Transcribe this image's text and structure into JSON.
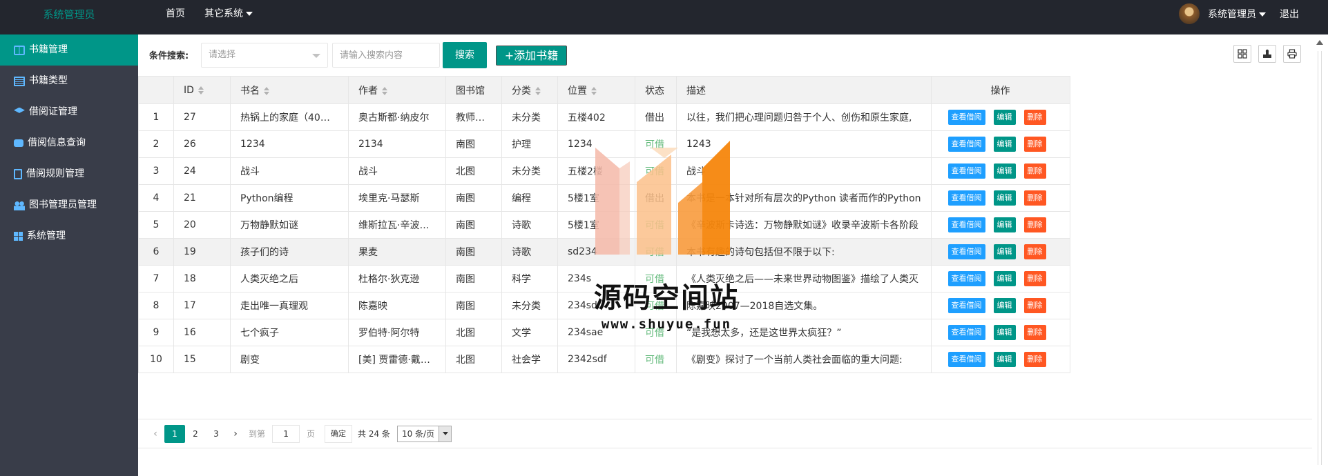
{
  "header": {
    "logo": "系统管理员",
    "nav": [
      "首页",
      "其它系统"
    ],
    "username": "系统管理员",
    "logout": "退出"
  },
  "sidebar": {
    "items": [
      {
        "label": "书籍管理",
        "icon": "book-icon",
        "active": true
      },
      {
        "label": "书籍类型",
        "icon": "list-icon",
        "active": false
      },
      {
        "label": "借阅证管理",
        "icon": "layers-icon",
        "active": false
      },
      {
        "label": "借阅信息查询",
        "icon": "chat-icon",
        "active": false
      },
      {
        "label": "借阅规则管理",
        "icon": "document-icon",
        "active": false
      },
      {
        "label": "图书管理员管理",
        "icon": "users-icon",
        "active": false
      },
      {
        "label": "系统管理",
        "icon": "windows-icon",
        "active": false
      }
    ]
  },
  "toolbar": {
    "label": "条件搜索:",
    "select_placeholder": "请选择",
    "search_placeholder": "请输入搜索内容",
    "search_button": "搜索",
    "add_button": "+添加书籍"
  },
  "table": {
    "columns": [
      "",
      "ID",
      "书名",
      "作者",
      "图书馆",
      "分类",
      "位置",
      "状态",
      "描述",
      "操作"
    ],
    "ops": {
      "view": "查看借阅",
      "edit": "编辑",
      "delete": "删除"
    },
    "rows": [
      [
        "1",
        "27",
        "热锅上的家庭（40…",
        "奥古斯都·纳皮尔",
        "教师…",
        "未分类",
        "五楼402",
        "借出",
        "以往，我们把心理问题归咎于个人、创伤和原生家庭,"
      ],
      [
        "2",
        "26",
        "1234",
        "2134",
        "南图",
        "护理",
        "1234",
        "可借",
        "1243"
      ],
      [
        "3",
        "24",
        "战斗",
        "战斗",
        "北图",
        "未分类",
        "五楼2楼",
        "可借",
        "战斗"
      ],
      [
        "4",
        "21",
        "Python编程",
        "埃里克·马瑟斯",
        "南图",
        "编程",
        "5楼1室",
        "借出",
        "本书是一本针对所有层次的Python 读者而作的Python"
      ],
      [
        "5",
        "20",
        "万物静默如谜",
        "维斯拉瓦·辛波…",
        "南图",
        "诗歌",
        "5楼1室",
        "可借",
        "《辛波斯卡诗选：万物静默如谜》收录辛波斯卡各阶段"
      ],
      [
        "6",
        "19",
        "孩子们的诗",
        "果麦",
        "南图",
        "诗歌",
        "sd234",
        "可借",
        "本书有趣的诗句包括但不限于以下:"
      ],
      [
        "7",
        "18",
        "人类灭绝之后",
        "杜格尔·狄克逊",
        "南图",
        "科学",
        "234s",
        "可借",
        "《人类灭绝之后——未来世界动物图鉴》描绘了人类灭"
      ],
      [
        "8",
        "17",
        "走出唯一真理观",
        "陈嘉映",
        "南图",
        "未分类",
        "234sdf",
        "可借",
        "陈嘉映2007—2018自选文集。"
      ],
      [
        "9",
        "16",
        "七个疯子",
        "罗伯特·阿尔特",
        "北图",
        "文学",
        "234sae",
        "可借",
        "“是我想太多，还是这世界太疯狂？”"
      ],
      [
        "10",
        "15",
        "剧变",
        "[美] 贾雷德·戴…",
        "北图",
        "社会学",
        "2342sdf",
        "可借",
        "《剧变》探讨了一个当前人类社会面临的重大问题:"
      ]
    ]
  },
  "pager": {
    "pages": [
      "1",
      "2",
      "3"
    ],
    "goto_label": "到第",
    "page_value": "1",
    "page_unit": "页",
    "confirm": "确定",
    "total": "共 24 条",
    "page_size": "10 条/页"
  },
  "watermark": {
    "title": "源码空间站",
    "url": "www.shuyue.fun"
  },
  "colors": {
    "primary": "#009688",
    "header_bg": "#23262e",
    "sidebar_bg": "#393d49",
    "view_btn": "#1e9fff",
    "delete_btn": "#ff5722",
    "available": "#5fb878"
  }
}
